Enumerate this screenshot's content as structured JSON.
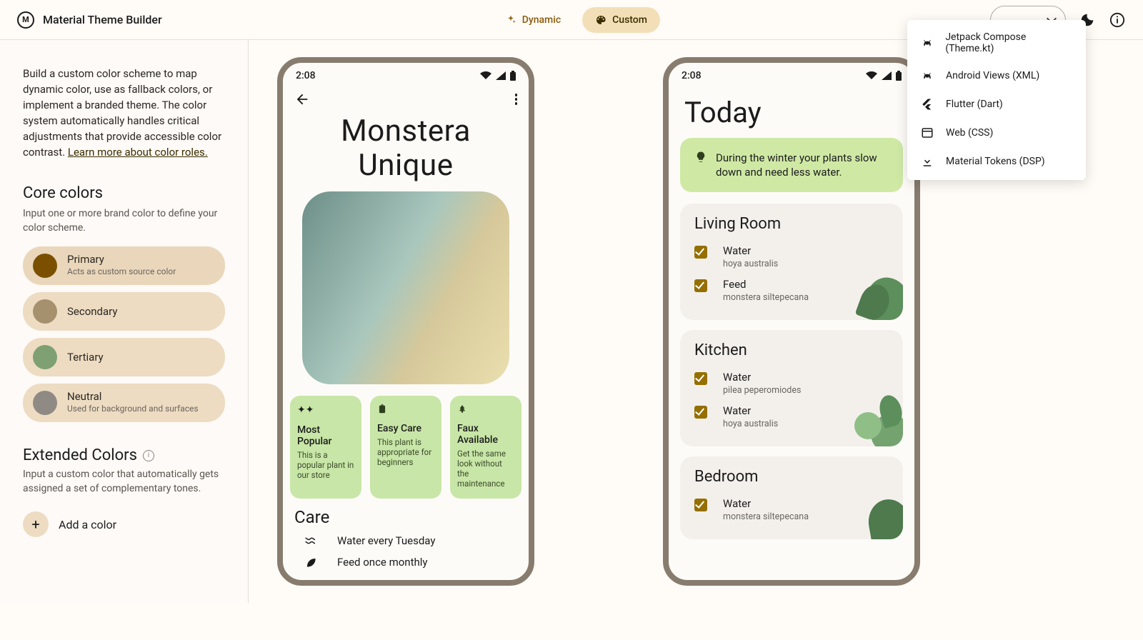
{
  "topbar": {
    "title": "Material Theme Builder",
    "dynamic_label": "Dynamic",
    "custom_label": "Custom"
  },
  "export_menu": {
    "items": [
      {
        "label": "Jetpack Compose (Theme.kt)",
        "icon": "android-icon"
      },
      {
        "label": "Android Views (XML)",
        "icon": "android-icon"
      },
      {
        "label": "Flutter (Dart)",
        "icon": "flutter-icon"
      },
      {
        "label": "Web (CSS)",
        "icon": "web-icon"
      },
      {
        "label": "Material Tokens (DSP)",
        "icon": "download-icon"
      }
    ]
  },
  "sidebar": {
    "intro": "Build a custom color scheme to map dynamic color, use as fallback colors, or implement a branded theme. The color system automatically handles critical adjustments that provide accessible color contrast. ",
    "intro_link": "Learn more about color roles.",
    "core_heading": "Core colors",
    "core_sub": "Input one or more brand color to define your color scheme.",
    "colors": [
      {
        "name": "Primary",
        "sub": "Acts as custom source color",
        "swatch": "#7a5000"
      },
      {
        "name": "Secondary",
        "sub": "",
        "swatch": "#a6916f"
      },
      {
        "name": "Tertiary",
        "sub": "",
        "swatch": "#7fa072"
      },
      {
        "name": "Neutral",
        "sub": "Used for background and surfaces",
        "swatch": "#8f8a84"
      }
    ],
    "ext_heading": "Extended Colors",
    "ext_sub": "Input a custom color that automatically gets assigned a set of complementary tones.",
    "add_label": "Add a color"
  },
  "phone1": {
    "time": "2:08",
    "title_line1": "Monstera",
    "title_line2": "Unique",
    "cards": [
      {
        "t": "Most Popular",
        "s": "This is a popular plant in our store"
      },
      {
        "t": "Easy Care",
        "s": "This plant is appropriate for beginners"
      },
      {
        "t": "Faux Available",
        "s": "Get the same look without the maintenance"
      }
    ],
    "care_h": "Care",
    "care_rows": [
      {
        "icon": "waves-icon",
        "label": "Water every Tuesday"
      },
      {
        "icon": "leaf-icon",
        "label": "Feed once monthly"
      }
    ]
  },
  "phone2": {
    "time": "2:08",
    "today": "Today",
    "tip": "During the winter your plants slow down and need less water.",
    "rooms": [
      {
        "name": "Living Room",
        "tasks": [
          {
            "t": "Water",
            "s": "hoya australis"
          },
          {
            "t": "Feed",
            "s": "monstera siltepecana"
          }
        ]
      },
      {
        "name": "Kitchen",
        "tasks": [
          {
            "t": "Water",
            "s": "pilea peperomiodes"
          },
          {
            "t": "Water",
            "s": "hoya australis"
          }
        ]
      },
      {
        "name": "Bedroom",
        "tasks": [
          {
            "t": "Water",
            "s": "monstera siltepecana"
          }
        ]
      }
    ]
  }
}
